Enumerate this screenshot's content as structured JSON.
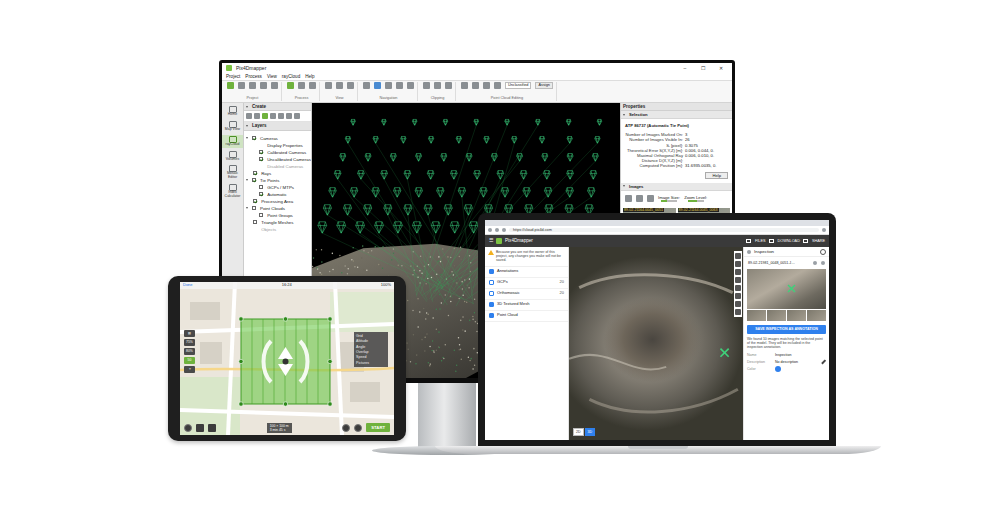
{
  "monitor": {
    "title": "Pix4Dmapper",
    "window_controls": [
      "–",
      "☐",
      "✕"
    ],
    "menu": [
      "Project",
      "Process",
      "View",
      "rayCloud",
      "Help"
    ],
    "toolbar_groups": [
      "Project",
      "Process",
      "View",
      "Navigation",
      "Clipping",
      "Point Cloud Editing"
    ],
    "toolbar_fields": [
      "Unclassified",
      "Assign"
    ],
    "nav": [
      {
        "label": "Home",
        "selected": false
      },
      {
        "label": "Map View",
        "selected": false
      },
      {
        "label": "rayCloud",
        "selected": true
      },
      {
        "label": "Volumes",
        "selected": false
      },
      {
        "label": "Mosaic Editor",
        "selected": false
      },
      {
        "label": "Index Calculator",
        "selected": false
      }
    ],
    "create_title": "Create",
    "layers_title": "Layers",
    "layers": [
      {
        "label": "Cameras",
        "kind": "checkbox",
        "checked": true,
        "disabled": false,
        "children": [
          {
            "label": "Display Properties",
            "kind": "plain",
            "disabled": false,
            "children": []
          },
          {
            "label": "Calibrated Cameras",
            "kind": "checkbox",
            "checked": true,
            "disabled": false,
            "children": []
          },
          {
            "label": "Uncalibrated Cameras",
            "kind": "checkbox",
            "checked": true,
            "disabled": false,
            "children": []
          },
          {
            "label": "Disabled Cameras",
            "kind": "plain",
            "disabled": true,
            "children": []
          }
        ]
      },
      {
        "label": "Rays",
        "kind": "checkbox",
        "checked": true,
        "disabled": false,
        "children": []
      },
      {
        "label": "Tie Points",
        "kind": "checkbox",
        "checked": true,
        "disabled": false,
        "children": [
          {
            "label": "GCPs / MTPs",
            "kind": "checkbox",
            "checked": false,
            "disabled": false,
            "children": []
          },
          {
            "label": "Automatic",
            "kind": "checkbox",
            "checked": true,
            "disabled": false,
            "children": []
          }
        ]
      },
      {
        "label": "Processing Area",
        "kind": "checkbox",
        "checked": true,
        "disabled": false,
        "children": []
      },
      {
        "label": "Point Clouds",
        "kind": "checkbox",
        "checked": false,
        "disabled": false,
        "children": [
          {
            "label": "Point Groups",
            "kind": "checkbox",
            "checked": false,
            "disabled": false,
            "children": []
          }
        ]
      },
      {
        "label": "Triangle Meshes",
        "kind": "checkbox",
        "checked": false,
        "disabled": false,
        "children": []
      },
      {
        "label": "Objects",
        "kind": "plain",
        "disabled": true,
        "children": []
      }
    ],
    "properties": {
      "title": "Properties",
      "section": "Selection",
      "heading": "ATP 86737 (Automatic Tie Point)",
      "rows": [
        {
          "label": "Number of Images Marked On:",
          "value": "3"
        },
        {
          "label": "Number of Images Visible In:",
          "value": "26"
        },
        {
          "label": "Sᵢ [pixel]:",
          "value": "0.3075"
        },
        {
          "label": "Theoretical Error S(X,Y,Z) [m]:",
          "value": "0.006, 0.044, 0."
        },
        {
          "label": "Maximal Orthogonal Ray Distance D(X,Y,Z) [m]:",
          "value": "0.006, 0.010, 0."
        },
        {
          "label": "Computed Position [m]:",
          "value": "31.6935.0035, 0."
        }
      ],
      "help": "Help"
    },
    "images": {
      "title": "Images",
      "sliders": [
        {
          "label": "Image Size:",
          "level": 0.35
        },
        {
          "label": "Zoom Level:",
          "level": 0.6
        }
      ],
      "thumbnails": [
        "89-02-21164.0045_0051",
        "89-02-21164.0045_0063"
      ]
    }
  },
  "tablet": {
    "back": "Done",
    "time": "16:24",
    "battery": "100%",
    "side_buttons": [
      {
        "label": "▤",
        "selected": false
      },
      {
        "label": "75%",
        "selected": false
      },
      {
        "label": "80%",
        "selected": false
      },
      {
        "label": "50",
        "selected": true
      },
      {
        "label": "⌖",
        "selected": false
      }
    ],
    "settings": [
      "Grid",
      "Altitude",
      "Angle",
      "Overlap",
      "Speed",
      "Pictures"
    ],
    "info": [
      "100 × 100 m",
      "3 min 45 s"
    ],
    "start": "START"
  },
  "laptop": {
    "url": "https://cloud.pix4d.com",
    "menu_icon": "☰",
    "app_title": "Pix4Dmapper",
    "actions": [
      "FILES",
      "DOWNLOAD",
      "SHARE"
    ],
    "notice": "Because you are not the owner of this project, any changes you make will not be saved.",
    "layers": [
      {
        "label": "Annotations",
        "checked": true,
        "count": ""
      },
      {
        "label": "GCPs",
        "checked": false,
        "count": "20"
      },
      {
        "label": "Orthomosaic",
        "checked": false,
        "count": "20"
      },
      {
        "label": "3D Textured Mesh",
        "checked": true,
        "count": ""
      },
      {
        "label": "Point Cloud",
        "checked": true,
        "count": ""
      }
    ],
    "view_toggle": [
      {
        "label": "2D",
        "selected": false
      },
      {
        "label": "3D",
        "selected": true
      }
    ],
    "inspection": {
      "title": "Inspection",
      "image": "89-02-21981_0048_0051.J…",
      "button": "SAVE INSPECTION AS ANNOTATION",
      "message": "We found 10 images matching the selected point of the model. They will be included in the inspection annotation.",
      "name": {
        "label": "Name",
        "value": "Inspection"
      },
      "description": {
        "label": "Description",
        "value": "No description"
      },
      "color": {
        "label": "Color",
        "value": "#2f80ed"
      }
    }
  }
}
